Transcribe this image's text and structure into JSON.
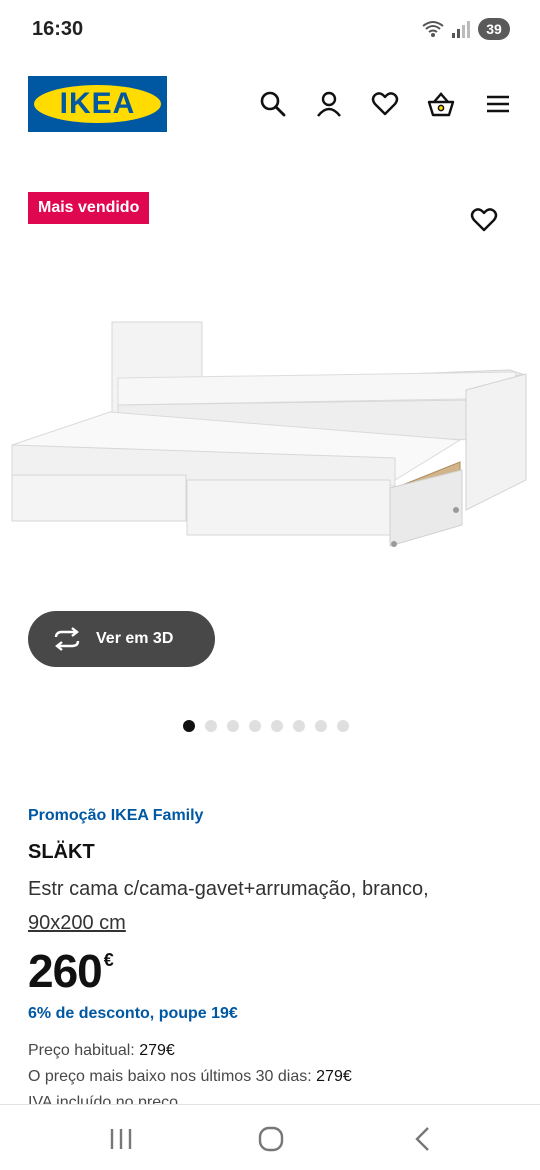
{
  "status_bar": {
    "time": "16:30",
    "battery": "39",
    "icons": [
      "wifi-icon",
      "signal-icon",
      "battery-icon"
    ]
  },
  "header": {
    "logo_text": "IKEA",
    "icons": [
      "search-icon",
      "user-icon",
      "heart-icon",
      "basket-icon",
      "menu-icon"
    ]
  },
  "gallery": {
    "badge": "Mais vendido",
    "view_3d_label": "Ver em 3D",
    "slide_count": 8,
    "active_slide": 1
  },
  "product": {
    "promo": "Promoção IKEA Family",
    "name": "SLÄKT",
    "description": "Estr cama c/cama-gavet+arrumação, branco,",
    "size": "90x200 cm",
    "price": "260",
    "currency": "€",
    "discount": "6% de desconto, poupe 19€",
    "regular_label": "Preço habitual: ",
    "regular_value": "279€",
    "lowest_label": "O preço mais baixo nos últimos 30 dias: ",
    "lowest_value": "279€",
    "vat": "IVA incluído no preço"
  },
  "colors": {
    "brand_blue": "#0058a3",
    "brand_yellow": "#ffdb00",
    "badge_red": "#e00751",
    "button_dark": "#484848"
  },
  "nav_bar": {
    "icons": [
      "recent-apps-icon",
      "home-icon",
      "back-icon"
    ]
  }
}
